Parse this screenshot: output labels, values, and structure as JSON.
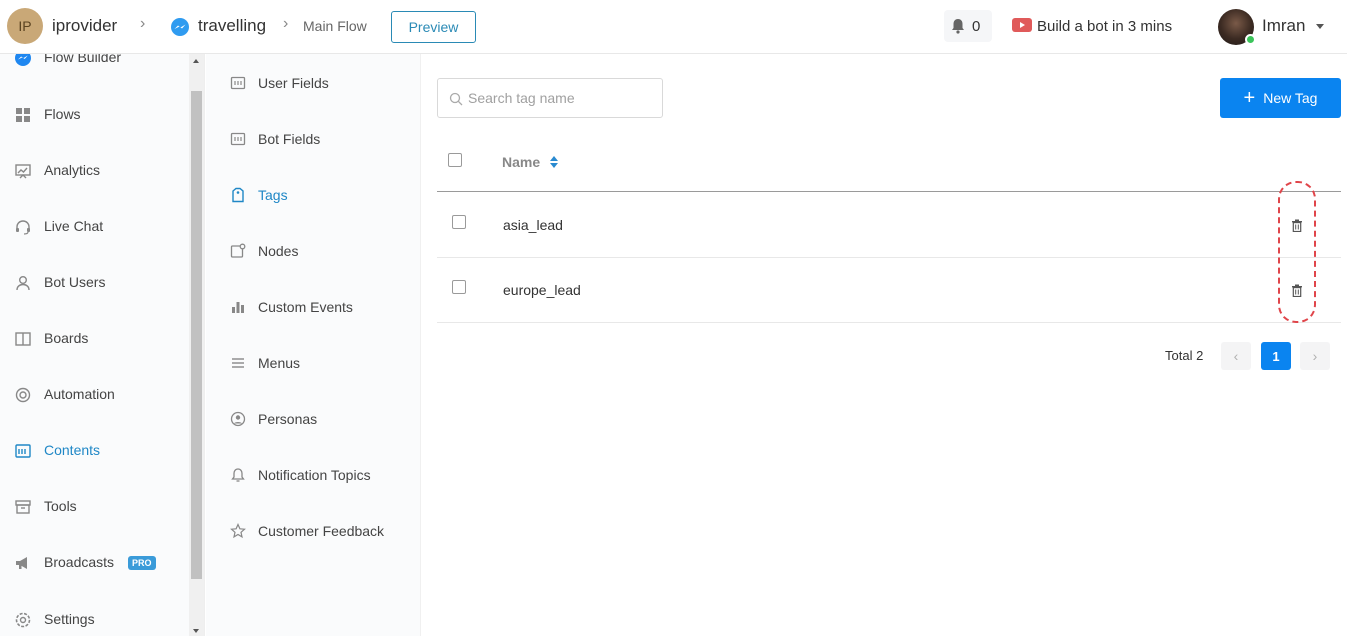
{
  "topbar": {
    "workspace_initials": "IP",
    "workspace_name": "iprovider",
    "sep1": "›",
    "bot_name": "travelling",
    "sep2": "›",
    "flow_name": "Main Flow",
    "preview_label": "Preview",
    "notification_count": "0",
    "build_bot_text": "Build a bot in 3 mins",
    "user_name": "Imran"
  },
  "sidebar": {
    "items": [
      {
        "label": "Flow Builder",
        "icon": "messenger-icon"
      },
      {
        "label": "Flows",
        "icon": "grid-icon"
      },
      {
        "label": "Analytics",
        "icon": "analytics-icon"
      },
      {
        "label": "Live Chat",
        "icon": "headset-icon"
      },
      {
        "label": "Bot Users",
        "icon": "user-icon"
      },
      {
        "label": "Boards",
        "icon": "board-icon"
      },
      {
        "label": "Automation",
        "icon": "automation-icon"
      },
      {
        "label": "Contents",
        "icon": "contents-icon",
        "active": true
      },
      {
        "label": "Tools",
        "icon": "tools-icon"
      },
      {
        "label": "Broadcasts",
        "icon": "megaphone-icon",
        "badge": "PRO"
      },
      {
        "label": "Settings",
        "icon": "gear-icon"
      }
    ]
  },
  "subnav": {
    "items": [
      {
        "label": "User Fields",
        "icon": "field-icon"
      },
      {
        "label": "Bot Fields",
        "icon": "field-icon"
      },
      {
        "label": "Tags",
        "icon": "tag-icon",
        "active": true
      },
      {
        "label": "Nodes",
        "icon": "node-icon"
      },
      {
        "label": "Custom Events",
        "icon": "bar-chart-icon"
      },
      {
        "label": "Menus",
        "icon": "menu-icon"
      },
      {
        "label": "Personas",
        "icon": "persona-icon"
      },
      {
        "label": "Notification Topics",
        "icon": "bell-icon"
      },
      {
        "label": "Customer Feedback",
        "icon": "star-icon"
      }
    ]
  },
  "main": {
    "search_placeholder": "Search tag name",
    "search_value": "",
    "new_tag_label": "New Tag",
    "table": {
      "column_name": "Name",
      "rows": [
        {
          "name": "asia_lead"
        },
        {
          "name": "europe_lead"
        }
      ]
    },
    "pagination": {
      "total_text": "Total 2",
      "current_page": "1",
      "prev": "‹",
      "next": "›"
    }
  },
  "colors": {
    "accent": "#0a84f0",
    "active_nav": "#1f87c6",
    "highlight": "#e0454a"
  }
}
